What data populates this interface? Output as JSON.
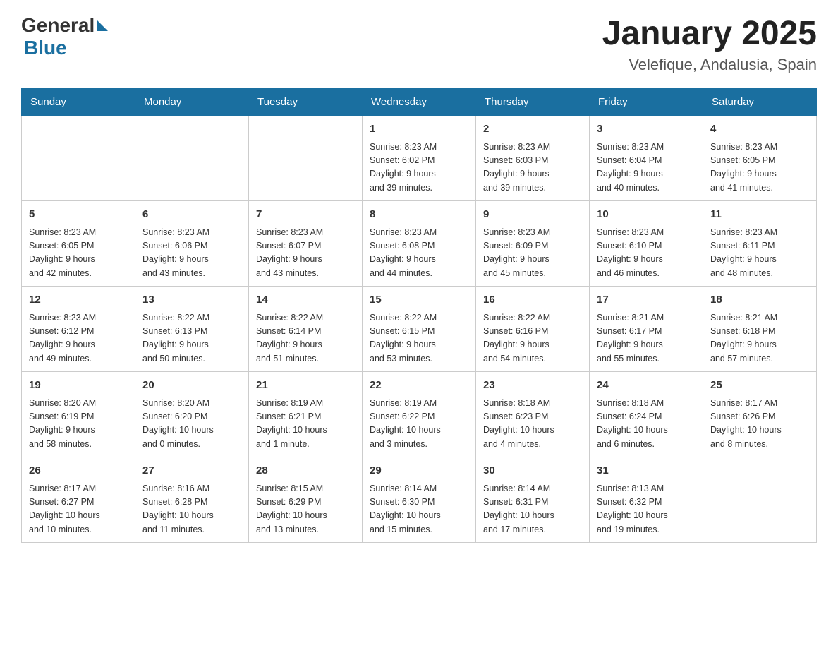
{
  "header": {
    "logo_general": "General",
    "logo_blue": "Blue",
    "month_title": "January 2025",
    "location": "Velefique, Andalusia, Spain"
  },
  "weekdays": [
    "Sunday",
    "Monday",
    "Tuesday",
    "Wednesday",
    "Thursday",
    "Friday",
    "Saturday"
  ],
  "weeks": [
    [
      {
        "day": "",
        "info": ""
      },
      {
        "day": "",
        "info": ""
      },
      {
        "day": "",
        "info": ""
      },
      {
        "day": "1",
        "info": "Sunrise: 8:23 AM\nSunset: 6:02 PM\nDaylight: 9 hours\nand 39 minutes."
      },
      {
        "day": "2",
        "info": "Sunrise: 8:23 AM\nSunset: 6:03 PM\nDaylight: 9 hours\nand 39 minutes."
      },
      {
        "day": "3",
        "info": "Sunrise: 8:23 AM\nSunset: 6:04 PM\nDaylight: 9 hours\nand 40 minutes."
      },
      {
        "day": "4",
        "info": "Sunrise: 8:23 AM\nSunset: 6:05 PM\nDaylight: 9 hours\nand 41 minutes."
      }
    ],
    [
      {
        "day": "5",
        "info": "Sunrise: 8:23 AM\nSunset: 6:05 PM\nDaylight: 9 hours\nand 42 minutes."
      },
      {
        "day": "6",
        "info": "Sunrise: 8:23 AM\nSunset: 6:06 PM\nDaylight: 9 hours\nand 43 minutes."
      },
      {
        "day": "7",
        "info": "Sunrise: 8:23 AM\nSunset: 6:07 PM\nDaylight: 9 hours\nand 43 minutes."
      },
      {
        "day": "8",
        "info": "Sunrise: 8:23 AM\nSunset: 6:08 PM\nDaylight: 9 hours\nand 44 minutes."
      },
      {
        "day": "9",
        "info": "Sunrise: 8:23 AM\nSunset: 6:09 PM\nDaylight: 9 hours\nand 45 minutes."
      },
      {
        "day": "10",
        "info": "Sunrise: 8:23 AM\nSunset: 6:10 PM\nDaylight: 9 hours\nand 46 minutes."
      },
      {
        "day": "11",
        "info": "Sunrise: 8:23 AM\nSunset: 6:11 PM\nDaylight: 9 hours\nand 48 minutes."
      }
    ],
    [
      {
        "day": "12",
        "info": "Sunrise: 8:23 AM\nSunset: 6:12 PM\nDaylight: 9 hours\nand 49 minutes."
      },
      {
        "day": "13",
        "info": "Sunrise: 8:22 AM\nSunset: 6:13 PM\nDaylight: 9 hours\nand 50 minutes."
      },
      {
        "day": "14",
        "info": "Sunrise: 8:22 AM\nSunset: 6:14 PM\nDaylight: 9 hours\nand 51 minutes."
      },
      {
        "day": "15",
        "info": "Sunrise: 8:22 AM\nSunset: 6:15 PM\nDaylight: 9 hours\nand 53 minutes."
      },
      {
        "day": "16",
        "info": "Sunrise: 8:22 AM\nSunset: 6:16 PM\nDaylight: 9 hours\nand 54 minutes."
      },
      {
        "day": "17",
        "info": "Sunrise: 8:21 AM\nSunset: 6:17 PM\nDaylight: 9 hours\nand 55 minutes."
      },
      {
        "day": "18",
        "info": "Sunrise: 8:21 AM\nSunset: 6:18 PM\nDaylight: 9 hours\nand 57 minutes."
      }
    ],
    [
      {
        "day": "19",
        "info": "Sunrise: 8:20 AM\nSunset: 6:19 PM\nDaylight: 9 hours\nand 58 minutes."
      },
      {
        "day": "20",
        "info": "Sunrise: 8:20 AM\nSunset: 6:20 PM\nDaylight: 10 hours\nand 0 minutes."
      },
      {
        "day": "21",
        "info": "Sunrise: 8:19 AM\nSunset: 6:21 PM\nDaylight: 10 hours\nand 1 minute."
      },
      {
        "day": "22",
        "info": "Sunrise: 8:19 AM\nSunset: 6:22 PM\nDaylight: 10 hours\nand 3 minutes."
      },
      {
        "day": "23",
        "info": "Sunrise: 8:18 AM\nSunset: 6:23 PM\nDaylight: 10 hours\nand 4 minutes."
      },
      {
        "day": "24",
        "info": "Sunrise: 8:18 AM\nSunset: 6:24 PM\nDaylight: 10 hours\nand 6 minutes."
      },
      {
        "day": "25",
        "info": "Sunrise: 8:17 AM\nSunset: 6:26 PM\nDaylight: 10 hours\nand 8 minutes."
      }
    ],
    [
      {
        "day": "26",
        "info": "Sunrise: 8:17 AM\nSunset: 6:27 PM\nDaylight: 10 hours\nand 10 minutes."
      },
      {
        "day": "27",
        "info": "Sunrise: 8:16 AM\nSunset: 6:28 PM\nDaylight: 10 hours\nand 11 minutes."
      },
      {
        "day": "28",
        "info": "Sunrise: 8:15 AM\nSunset: 6:29 PM\nDaylight: 10 hours\nand 13 minutes."
      },
      {
        "day": "29",
        "info": "Sunrise: 8:14 AM\nSunset: 6:30 PM\nDaylight: 10 hours\nand 15 minutes."
      },
      {
        "day": "30",
        "info": "Sunrise: 8:14 AM\nSunset: 6:31 PM\nDaylight: 10 hours\nand 17 minutes."
      },
      {
        "day": "31",
        "info": "Sunrise: 8:13 AM\nSunset: 6:32 PM\nDaylight: 10 hours\nand 19 minutes."
      },
      {
        "day": "",
        "info": ""
      }
    ]
  ]
}
